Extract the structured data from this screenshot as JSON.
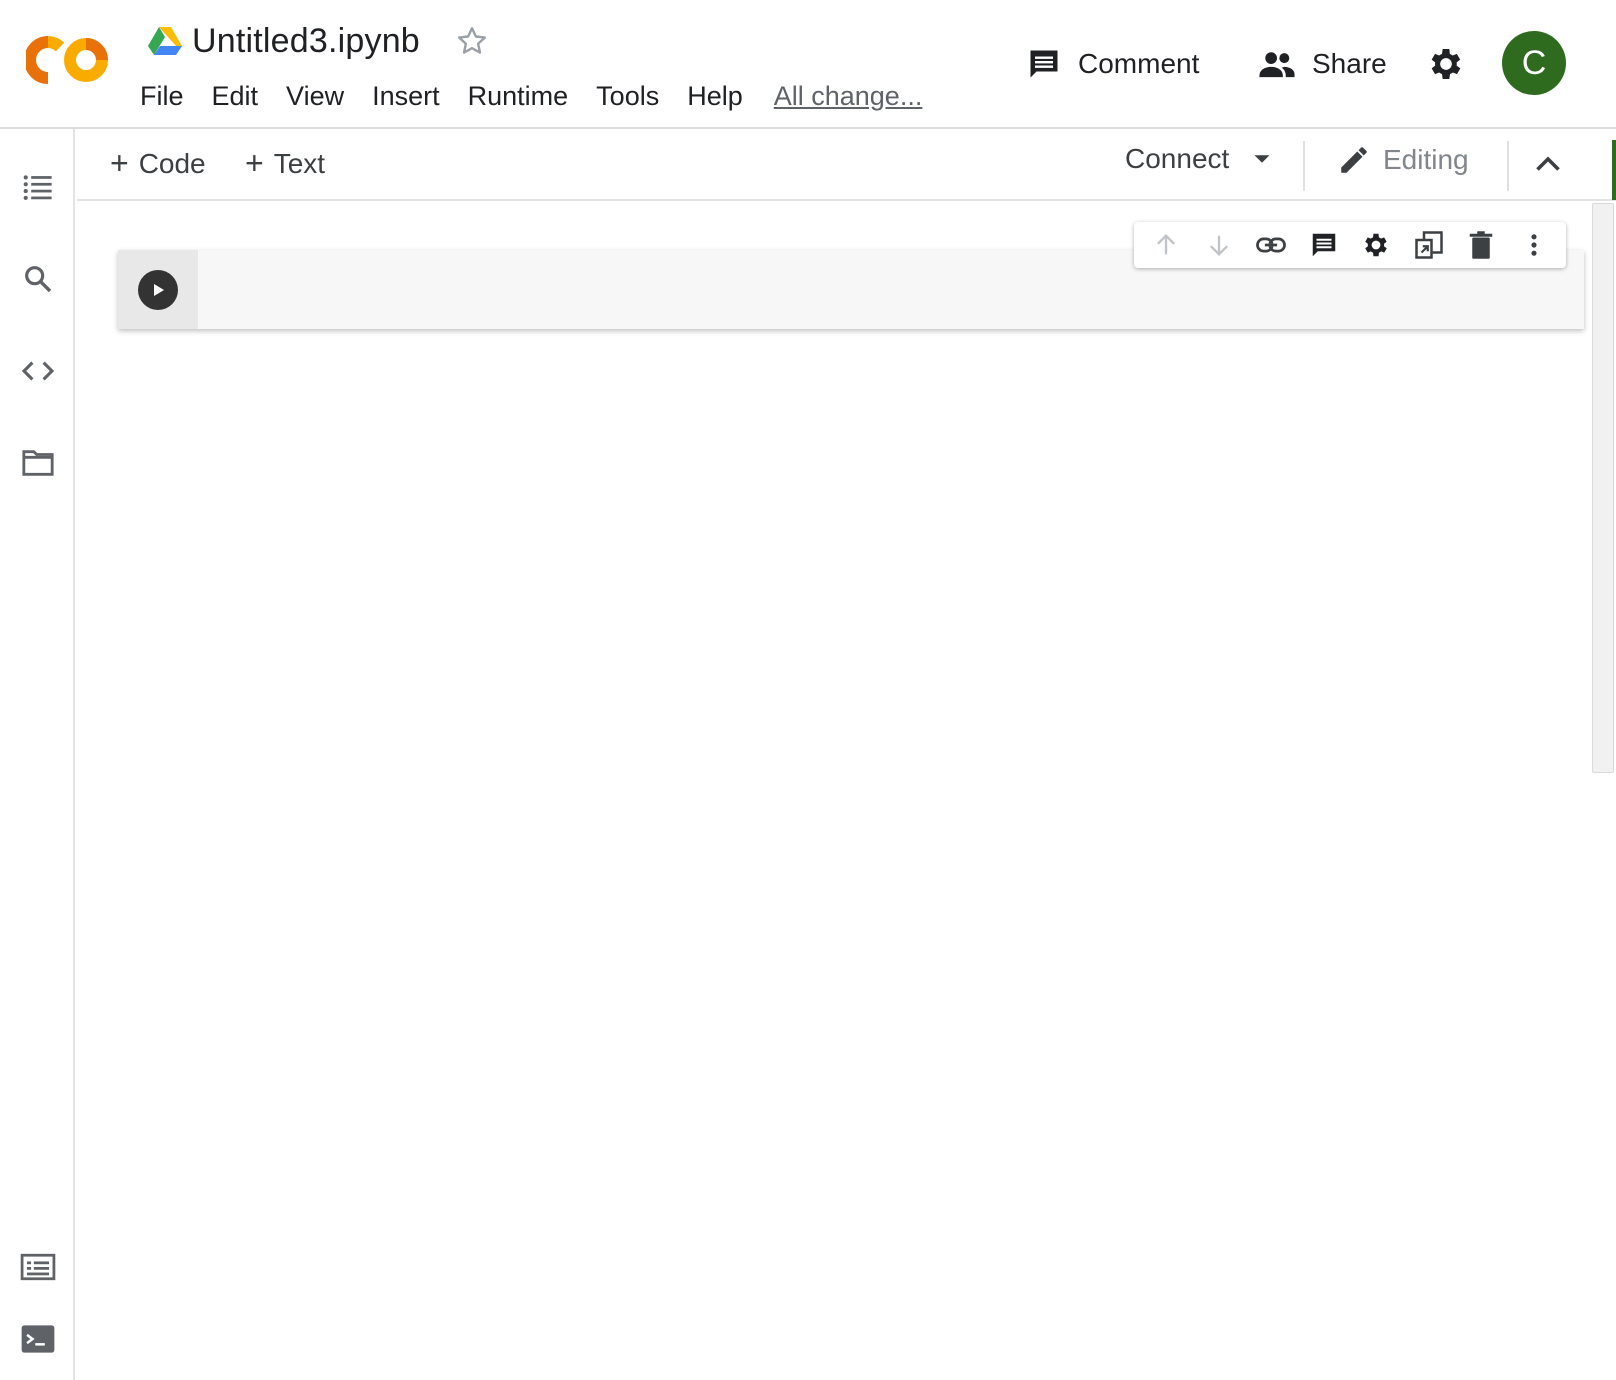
{
  "header": {
    "title": "Untitled3.ipynb",
    "menu": [
      "File",
      "Edit",
      "View",
      "Insert",
      "Runtime",
      "Tools",
      "Help"
    ],
    "save_status": "All change...",
    "comment_label": "Comment",
    "share_label": "Share",
    "avatar_letter": "C",
    "avatar_color": "#2e6b1f",
    "logo_colors": [
      "#e8710a",
      "#f9ab00"
    ]
  },
  "toolbar": {
    "add_code_label": "Code",
    "add_text_label": "Text",
    "connect_label": "Connect",
    "editing_label": "Editing"
  },
  "sidebar": {
    "items": [
      "table-of-contents-icon",
      "search-icon",
      "code-snippets-icon",
      "files-icon"
    ],
    "bottom_items": [
      "command-palette-icon",
      "terminal-icon"
    ]
  },
  "cell": {
    "code": "",
    "toolbar_icons": [
      "move-up-icon",
      "move-down-icon",
      "link-icon",
      "comment-icon",
      "settings-icon",
      "mirror-cell-icon",
      "delete-icon",
      "more-options-icon"
    ]
  }
}
